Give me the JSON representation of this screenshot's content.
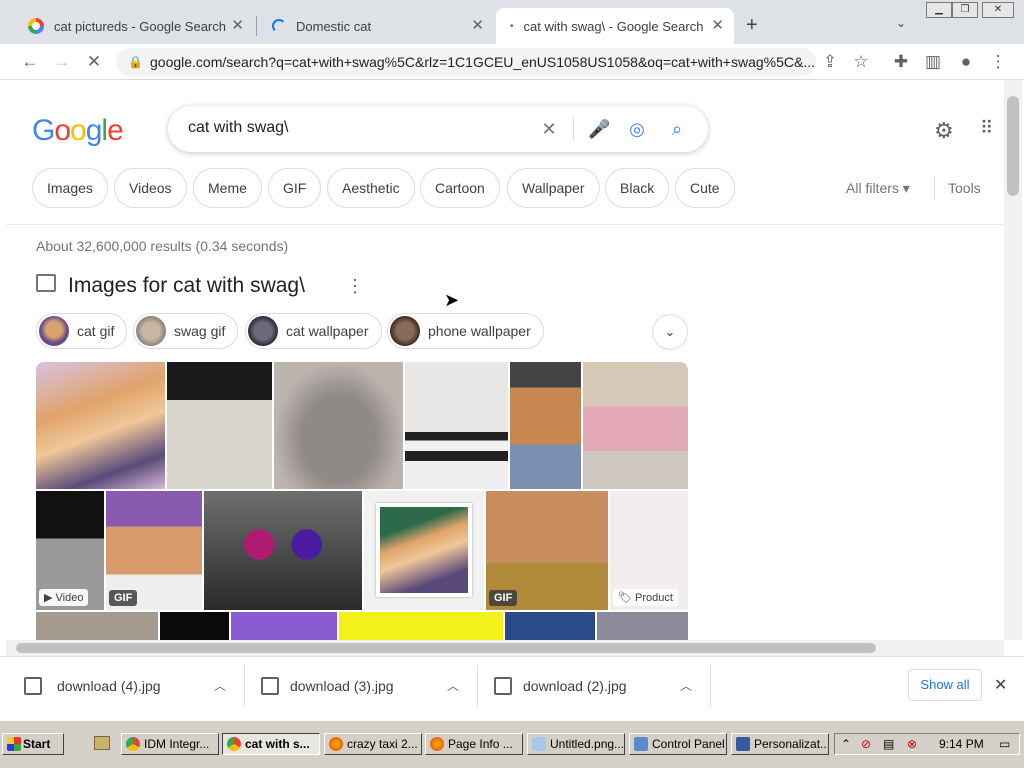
{
  "tabs": [
    {
      "title": "cat pictureds - Google Search",
      "icon": "google-favicon"
    },
    {
      "title": "Domestic cat",
      "icon": "loading-spinner"
    },
    {
      "title": "cat with swag\\ - Google Search",
      "icon": "loading-dot"
    }
  ],
  "url": "google.com/search?q=cat+with+swag%5C&rlz=1C1GCEU_enUS1058US1058&oq=cat+with+swag%5C&...",
  "search": {
    "query": "cat with swag\\",
    "logo": "Google"
  },
  "chips": [
    "Images",
    "Videos",
    "Meme",
    "GIF",
    "Aesthetic",
    "Cartoon",
    "Wallpaper",
    "Black",
    "Cute"
  ],
  "all_filters": "All filters",
  "tools": "Tools",
  "stats": "About 32,600,000 results (0.34 seconds)",
  "images_heading": "Images for cat with swag\\",
  "related": [
    "cat gif",
    "swag gif",
    "cat wallpaper",
    "phone wallpaper"
  ],
  "badges": {
    "video": "Video",
    "gif": "GIF",
    "product": "Product"
  },
  "downloads": [
    "download (4).jpg",
    "download (3).jpg",
    "download (2).jpg"
  ],
  "show_all": "Show all",
  "taskbar": {
    "start": "Start",
    "items": [
      "IDM Integr...",
      "cat with s...",
      "crazy taxi 2...",
      "Page Info ...",
      "Untitled.png...",
      "Control Panel",
      "Personalizat..."
    ],
    "clock": "9:14 PM"
  },
  "colors": {
    "accent": "#1a73e8",
    "logo_blue": "#4285f4",
    "logo_red": "#ea4335",
    "logo_yellow": "#fbbc05",
    "logo_green": "#34a853"
  }
}
